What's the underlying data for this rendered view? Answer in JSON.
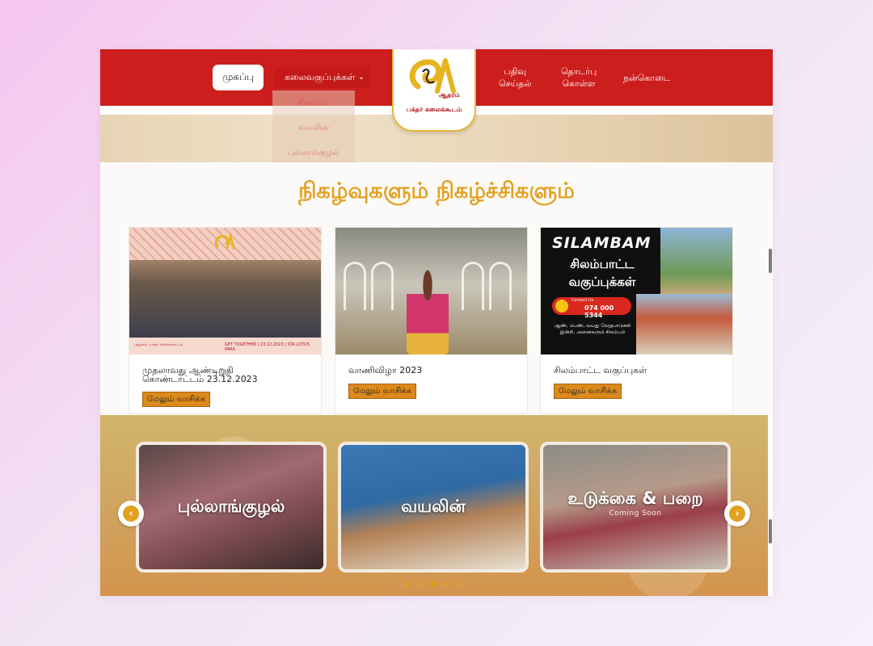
{
  "nav": {
    "home": "முகப்பு",
    "courses": "கலைவகுப்புக்கள்",
    "register_line1": "பதிவு",
    "register_line2": "செய்தல்",
    "contact_line1": "தொடர்பு",
    "contact_line2": "கொள்ள",
    "donate": "நன்கொடை",
    "dropdown": [
      "சிலம்பம்",
      "வயலின்",
      "புல்லாங்குழல்"
    ]
  },
  "logo": {
    "name": "ஆதரம்",
    "tagline": "பக்தர் கலைக்கூடம்"
  },
  "events": {
    "title": "நிகழ்வுகளும் நிகழ்ச்சிகளும்",
    "read_more": "மேலும் வாசிக்க",
    "cards": [
      {
        "title_line1": "முதலாவது ஆண்டிறுதி",
        "title_line2": "கொண்டாட்டம் 23.12.2023",
        "strip_left": "ஆதரம் பக்தர் கலைக்கூடம்",
        "strip_right": "GET TOGETHER | 23.12.2023 | STA LOTUS PARK"
      },
      {
        "title_line1": "வாணிவிழா 2023",
        "title_line2": ""
      },
      {
        "title_line1": "சிலம்பாட்ட வகுப்புகள்",
        "title_line2": "",
        "poster_heading": "SILAMBAM",
        "poster_line1": "சிலம்பாட்ட",
        "poster_line2": "வகுப்புக்கள்",
        "poster_contact": "Contact Us",
        "poster_phone": "074 000 5344",
        "poster_info": "ஆண், பெண், வயது வேறுபாடுகள் இன்றி, அனைவரும் சிலம்பம்"
      }
    ]
  },
  "carousel": {
    "slides": [
      {
        "title": "புல்லாங்குழல்",
        "sub": ""
      },
      {
        "title": "வயலின்",
        "sub": ""
      },
      {
        "title": "உடுக்கை & பறை",
        "sub": "Coming Soon"
      }
    ],
    "prev": "‹",
    "next": "›",
    "active_dot": 2
  },
  "colors": {
    "header": "#cc1e1d",
    "accent": "#e4a021",
    "button": "#dc8a1c"
  }
}
